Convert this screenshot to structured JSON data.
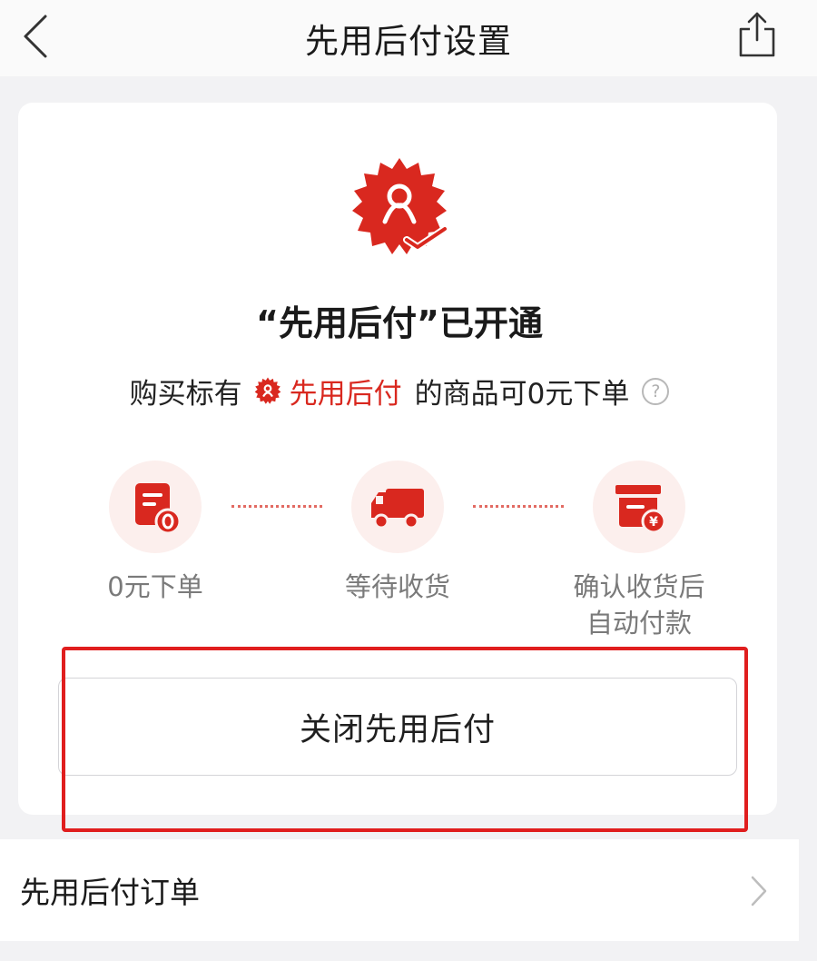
{
  "nav": {
    "title": "先用后付设置",
    "back_icon": "chevron-left-icon",
    "share_icon": "share-icon"
  },
  "status": {
    "badge_icon": "credit-badge-icon",
    "title": "“先用后付”已开通",
    "desc_prefix": "购买标有",
    "desc_highlight": "先用后付",
    "desc_suffix": "的商品可0元下单",
    "help_symbol": "?"
  },
  "steps": [
    {
      "label": "0元下单",
      "icon": "order-zero-icon"
    },
    {
      "label": "等待收货",
      "icon": "truck-icon"
    },
    {
      "label_line1": "确认收货后",
      "label_line2": "自动付款",
      "icon": "box-yuan-icon"
    }
  ],
  "actions": {
    "close_label": "关闭先用后付"
  },
  "orders": {
    "label": "先用后付订单"
  },
  "colors": {
    "accent": "#d9281f",
    "highlight_box": "#e01e1e",
    "background": "#f2f2f4",
    "step_bg": "#fcefed"
  }
}
